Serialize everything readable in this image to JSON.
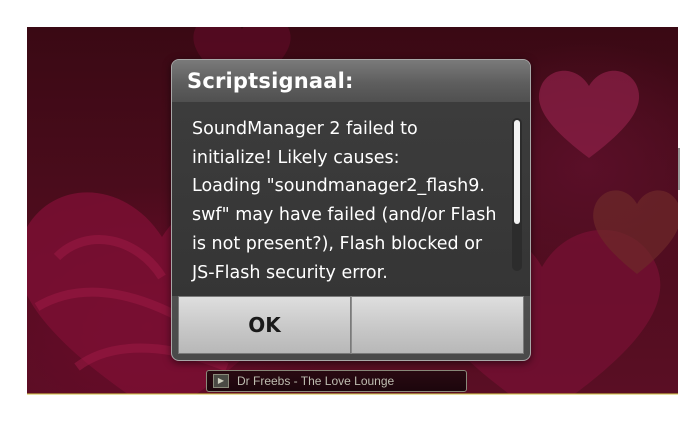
{
  "dialog": {
    "title": "Scriptsignaal:",
    "message": "SoundManager 2 failed to\ninitialize! Likely causes:\nLoading \"soundmanager2_flash9.\nswf\" may have failed (and/or Flash\nis not present?), Flash blocked or\nJS-Flash security error.",
    "ok_label": "OK",
    "second_button_label": ""
  },
  "player": {
    "now_playing": "Dr Freebs - The Love Lounge",
    "play_icon": "play-icon"
  },
  "colors": {
    "background_dark_red": "#4b0c1c",
    "heart_red": "#7a0f33",
    "dialog_gray": "#4a4a4a",
    "button_gray": "#c6c6c6"
  }
}
